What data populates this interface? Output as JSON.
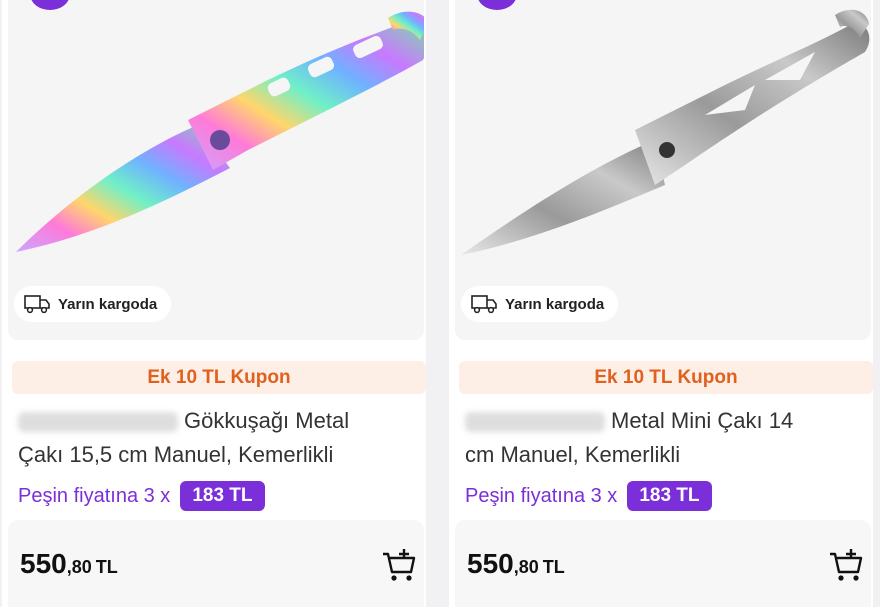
{
  "products": [
    {
      "name_suffix_line1": "Gökkuşağı Metal",
      "name_line2": "Çakı 15,5 cm Manuel, Kemerlikli",
      "shipping": "Yarın kargoda",
      "coupon": "Ek 10 TL Kupon",
      "installment_text": "Peşin fiyatına 3 x",
      "installment_amount": "183 TL",
      "price_int": "550",
      "price_dec": ",80",
      "currency": "TL",
      "knife_style": "rainbow"
    },
    {
      "name_suffix_line1": "Metal Mini Çakı 14",
      "name_line2": "cm Manuel, Kemerlikli",
      "shipping": "Yarın kargoda",
      "coupon": "Ek 10 TL Kupon",
      "installment_text": "Peşin fiyatına 3 x",
      "installment_amount": "183 TL",
      "price_int": "550",
      "price_dec": ",80",
      "currency": "TL",
      "knife_style": "silver"
    }
  ],
  "colors": {
    "accent_purple": "#7a2fd9",
    "coupon_orange": "#e0601e",
    "coupon_bg": "#fdeee6"
  },
  "icons": [
    "truck-icon",
    "add-to-cart-icon"
  ]
}
